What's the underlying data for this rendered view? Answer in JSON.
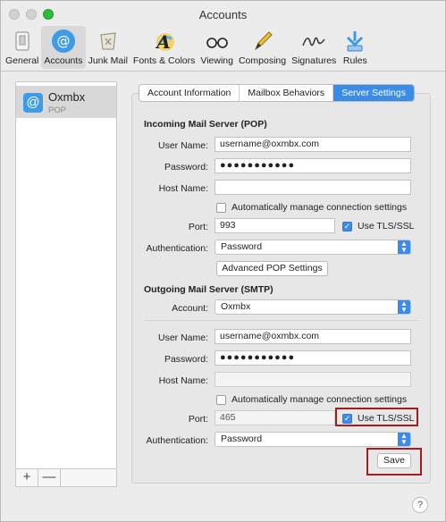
{
  "window": {
    "title": "Accounts"
  },
  "toolbar": {
    "items": [
      {
        "label": "General",
        "icon": "switch-icon"
      },
      {
        "label": "Accounts",
        "icon": "at-icon",
        "selected": true
      },
      {
        "label": "Junk Mail",
        "icon": "trash-icon"
      },
      {
        "label": "Fonts & Colors",
        "icon": "font-icon"
      },
      {
        "label": "Viewing",
        "icon": "glasses-icon"
      },
      {
        "label": "Composing",
        "icon": "pencil-icon"
      },
      {
        "label": "Signatures",
        "icon": "signature-icon"
      },
      {
        "label": "Rules",
        "icon": "rules-icon"
      }
    ]
  },
  "sidebar": {
    "account": {
      "name": "Oxmbx",
      "type": "POP"
    },
    "add_label": "+",
    "remove_label": "—"
  },
  "tabs": [
    {
      "label": "Account Information"
    },
    {
      "label": "Mailbox Behaviors"
    },
    {
      "label": "Server Settings",
      "active": true
    }
  ],
  "incoming": {
    "section_title": "Incoming Mail Server (POP)",
    "username_label": "User Name:",
    "username": "username@oxmbx.com",
    "password_label": "Password:",
    "password": "●●●●●●●●●●●",
    "hostname_label": "Host Name:",
    "hostname": "",
    "auto_manage_label": "Automatically manage connection settings",
    "port_label": "Port:",
    "port": "993",
    "tls_label": "Use TLS/SSL",
    "auth_label": "Authentication:",
    "auth": "Password",
    "advanced_button": "Advanced POP Settings"
  },
  "outgoing": {
    "section_title": "Outgoing Mail Server (SMTP)",
    "account_label": "Account:",
    "account": "Oxmbx",
    "username_label": "User Name:",
    "username": "username@oxmbx.com",
    "password_label": "Password:",
    "password": "●●●●●●●●●●●",
    "hostname_label": "Host Name:",
    "hostname": "",
    "auto_manage_label": "Automatically manage connection settings",
    "port_label": "Port:",
    "port": "465",
    "tls_label": "Use TLS/SSL",
    "auth_label": "Authentication:",
    "auth": "Password"
  },
  "save_button": "Save",
  "help_label": "?",
  "colors": {
    "accent": "#3b8ce8",
    "highlight": "#a61c1c"
  }
}
